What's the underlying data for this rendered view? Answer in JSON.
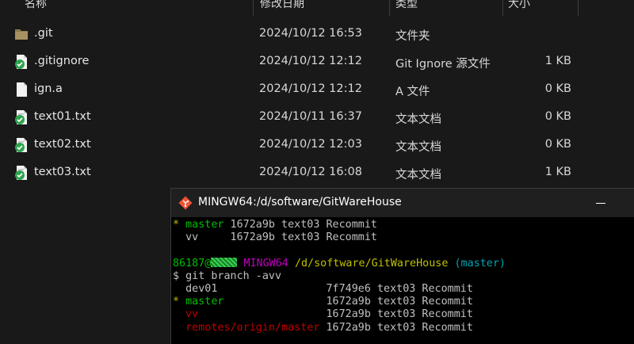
{
  "explorer": {
    "columns": {
      "name": "名称",
      "date": "修改日期",
      "type": "类型",
      "size": "大小"
    },
    "files": [
      {
        "icon": "folder-icon",
        "name": ".git",
        "date": "2024/10/12 16:53",
        "type": "文件夹",
        "size": ""
      },
      {
        "icon": "git-file-check-icon",
        "name": ".gitignore",
        "date": "2024/10/12 12:12",
        "type": "Git Ignore 源文件",
        "size": "1 KB"
      },
      {
        "icon": "file-icon",
        "name": "ign.a",
        "date": "2024/10/12 12:12",
        "type": "A 文件",
        "size": "0 KB"
      },
      {
        "icon": "git-file-check-icon",
        "name": "text01.txt",
        "date": "2024/10/11 16:37",
        "type": "文本文档",
        "size": "0 KB"
      },
      {
        "icon": "git-file-check-icon",
        "name": "text02.txt",
        "date": "2024/10/12 12:03",
        "type": "文本文档",
        "size": "0 KB"
      },
      {
        "icon": "git-file-check-icon",
        "name": "text03.txt",
        "date": "2024/10/12 16:08",
        "type": "文本文档",
        "size": "1 KB"
      }
    ]
  },
  "terminal": {
    "title": "MINGW64:/d/software/GitWareHouse",
    "lines": {
      "l1_star": "* ",
      "l1_branch": "master",
      "l1_rest": " 1672a9b text03 Recommit",
      "l2": "  vv     1672a9b text03 Recommit",
      "prompt_user": "86187@",
      "prompt_env": "MINGW64",
      "prompt_path": "/d/software/GitWareHouse",
      "prompt_branch": "(master)",
      "command": "$ git branch -avv",
      "b1": "  dev01                 7f749e6 text03 Recommit",
      "b2_star": "* ",
      "b2_branch": "master",
      "b2_rest": "                1672a9b text03 Recommit",
      "b3_branch": "vv",
      "b3_rest": "                    1672a9b text03 Recommit",
      "b4_branch": "remotes/origin/master",
      "b4_rest": " 1672a9b text03 Recommit"
    }
  },
  "colors": {
    "background": "#191919",
    "terminal_bg": "#000000",
    "branch_green": "#00bf00",
    "env_magenta": "#c000c0",
    "path_yellow": "#c0c000",
    "branch_cyan": "#00a6b2",
    "remote_red": "#c00000"
  }
}
